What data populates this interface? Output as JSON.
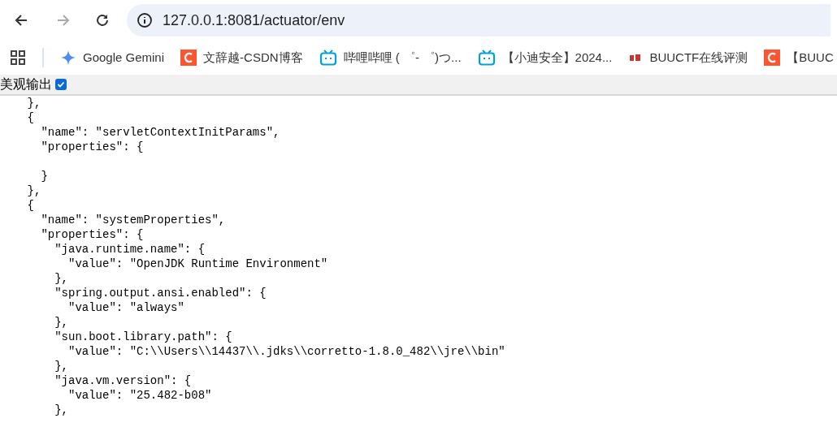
{
  "toolbar": {
    "url": "127.0.0.1:8081/actuator/env"
  },
  "bookmarks": [
    {
      "kind": "gemini",
      "label": "Google Gemini"
    },
    {
      "kind": "csdn",
      "label": "文辞越-CSDN博客"
    },
    {
      "kind": "bilibili",
      "label": "哔哩哔哩 ( ゜- ゜)つ..."
    },
    {
      "kind": "bilibili",
      "label": "【小迪安全】2024..."
    },
    {
      "kind": "buuctf",
      "label": "BUUCTF在线评测"
    },
    {
      "kind": "csdn",
      "label": "【BUUC"
    }
  ],
  "pretty_print": {
    "label": "美观输出",
    "checked": true
  },
  "json_lines": [
    {
      "text": "    },"
    },
    {
      "text": "    {"
    },
    {
      "text": "      \"name\": \"servletContextInitParams\","
    },
    {
      "text": "      \"properties\": {"
    },
    {
      "text": "      }",
      "blank_before": true
    },
    {
      "text": "    },"
    },
    {
      "text": "    {"
    },
    {
      "text": "      \"name\": \"systemProperties\","
    },
    {
      "text": "      \"properties\": {"
    },
    {
      "text": "        \"java.runtime.name\": {"
    },
    {
      "text": "          \"value\": \"OpenJDK Runtime Environment\""
    },
    {
      "text": "        },"
    },
    {
      "text": "        \"spring.output.ansi.enabled\": {"
    },
    {
      "text": "          \"value\": \"always\""
    },
    {
      "text": "        },"
    },
    {
      "text": "        \"sun.boot.library.path\": {"
    },
    {
      "text": "          \"value\": \"C:\\\\Users\\\\14437\\\\.jdks\\\\corretto-1.8.0_482\\\\jre\\\\bin\""
    },
    {
      "text": "        },"
    },
    {
      "text": "        \"java.vm.version\": {"
    },
    {
      "text": "          \"value\": \"25.482-b08\""
    },
    {
      "text": "        },"
    }
  ]
}
